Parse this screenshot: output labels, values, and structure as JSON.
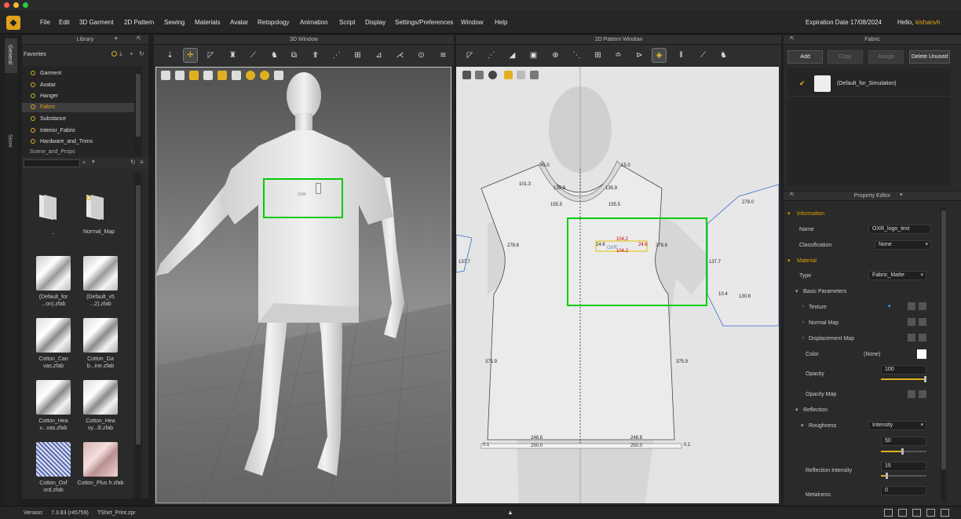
{
  "menu": [
    "File",
    "Edit",
    "3D Garment",
    "2D Pattern",
    "Sewing",
    "Materials",
    "Avatar",
    "Retopology",
    "Animation",
    "Script",
    "Display",
    "Settings/Preferences",
    "Window",
    "Help"
  ],
  "expiration": "Expiration Date 17/08/2024",
  "greeting": "Hello,",
  "username": "kishanvh",
  "side_tabs": [
    "General",
    "Store"
  ],
  "library": {
    "title": "Library",
    "favorites_label": "Favorites",
    "favorites": [
      "Garment",
      "Avatar",
      "Hanger",
      "Fabric",
      "Substance",
      "Interior_Fabric",
      "Hardware_and_Trims",
      "Scene_and_Props"
    ],
    "files": [
      {
        "label": ".."
      },
      {
        "label": "Normal_Map"
      },
      {
        "label": "(Default_for ...on).zfab"
      },
      {
        "label": "(Default_v5 ...2).zfab"
      },
      {
        "label": "Cotton_Can vas.zfab"
      },
      {
        "label": "Cotton_Ga b...ine.zfab"
      },
      {
        "label": "Cotton_Hea v...vas.zfab"
      },
      {
        "label": "Cotton_Hea vy...ill.zfab"
      },
      {
        "label": "Cotton_Oxf ord.zfab"
      },
      {
        "label": "Cotton_Plus h.zfab"
      }
    ]
  },
  "window3d": {
    "title": "3D Window",
    "logo_text": "OXR"
  },
  "window2d": {
    "title": "2D Pattern Window",
    "measurements": [
      "45.0",
      "15.0",
      "101.3",
      "135.9",
      "135.9",
      "155.5",
      "155.5",
      "279.0",
      "137.7",
      "278.8",
      "278.8",
      "104.2",
      "104.2",
      "24.6",
      "24.6",
      "137.7",
      "10.4",
      "130.8",
      "375.9",
      "375.9",
      "248.8",
      "248.8",
      "250.0",
      "250.0",
      "0.1",
      "0.1"
    ]
  },
  "fabric": {
    "title": "Fabric",
    "buttons": {
      "add": "Add",
      "copy": "Copy",
      "assign": "Assign",
      "delete": "Delete Unused"
    },
    "item": "(Default_for_Simulation)"
  },
  "property_editor": {
    "title": "Property Editor",
    "information": "Information",
    "name_label": "Name",
    "name_value": "OXR_logo_text",
    "classification_label": "Classification",
    "classification_value": "None",
    "material": "Material",
    "type_label": "Type",
    "type_value": "Fabric_Matte",
    "basic_params": "Basic Parameters",
    "texture": "Texture",
    "normal_map": "Normal Map",
    "displacement_map": "Displacement Map",
    "color_label": "Color",
    "color_value": "(None)",
    "opacity_label": "Opacity",
    "opacity_value": "100",
    "opacity_fraction": 1.0,
    "opacity_map": "Opacity Map",
    "reflection": "Reflection",
    "roughness_label": "Roughness",
    "roughness_mode": "Intensity",
    "roughness_value": "50",
    "roughness_fraction": 0.5,
    "refl_intensity_label": "Reflection Intensity",
    "refl_intensity_value": "15",
    "refl_intensity_fraction": 0.15,
    "metalness_label": "Metalness",
    "metalness_value": "0"
  },
  "status": {
    "version_label": "Version:",
    "version": "7.3.83 (r45759)",
    "file": "TShirt_Print.zpr"
  },
  "colors": {
    "accent": "#e0a21c",
    "highlight": "#00cc00"
  }
}
